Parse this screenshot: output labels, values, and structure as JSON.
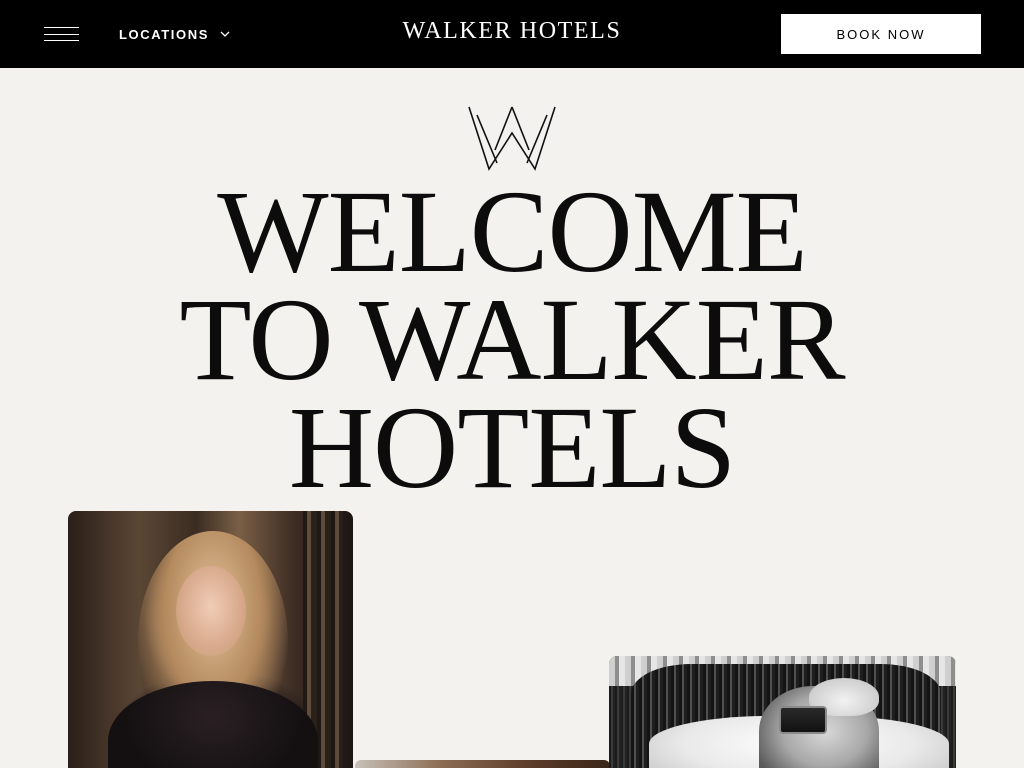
{
  "header": {
    "menu_icon": "hamburger-icon",
    "locations_label": "LOCATIONS",
    "locations_icon": "chevron-down-icon",
    "brand": "WALKER HOTELS",
    "book_label": "BOOK NOW"
  },
  "hero": {
    "logo_icon": "crown-w-logo",
    "line1": "WELCOME",
    "line2": "TO WALKER",
    "line3": "HOTELS"
  },
  "gallery": {
    "items": [
      "woman-portrait-photo",
      "interior-photo",
      "man-camera-photo"
    ]
  },
  "colors": {
    "background": "#f4f2ef",
    "topbar": "#000000",
    "text": "#0c0c0c",
    "button_bg": "#ffffff"
  }
}
